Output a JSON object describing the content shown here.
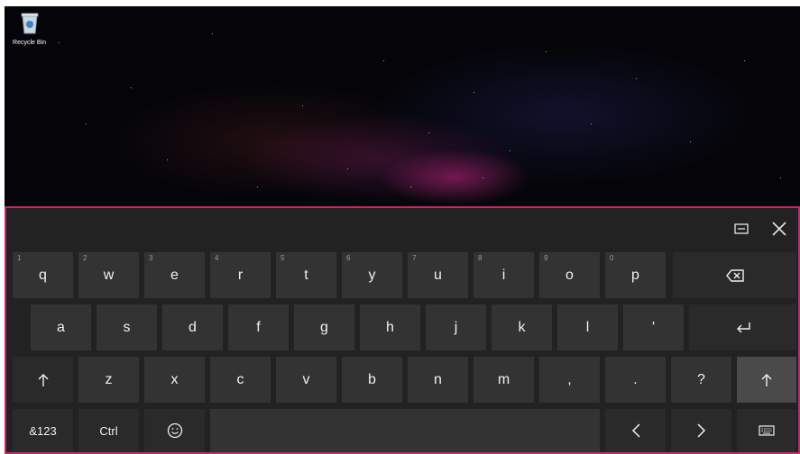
{
  "desktop": {
    "recycle_bin_label": "Recycle Bin"
  },
  "keyboard": {
    "row1": [
      {
        "hint": "1",
        "label": "q"
      },
      {
        "hint": "2",
        "label": "w"
      },
      {
        "hint": "3",
        "label": "e"
      },
      {
        "hint": "4",
        "label": "r"
      },
      {
        "hint": "5",
        "label": "t"
      },
      {
        "hint": "6",
        "label": "y"
      },
      {
        "hint": "7",
        "label": "u"
      },
      {
        "hint": "8",
        "label": "i"
      },
      {
        "hint": "9",
        "label": "o"
      },
      {
        "hint": "0",
        "label": "p"
      }
    ],
    "row2": [
      {
        "label": "a"
      },
      {
        "label": "s"
      },
      {
        "label": "d"
      },
      {
        "label": "f"
      },
      {
        "label": "g"
      },
      {
        "label": "h"
      },
      {
        "label": "j"
      },
      {
        "label": "k"
      },
      {
        "label": "l"
      },
      {
        "label": "'"
      }
    ],
    "row3": [
      {
        "label": "z"
      },
      {
        "label": "x"
      },
      {
        "label": "c"
      },
      {
        "label": "v"
      },
      {
        "label": "b"
      },
      {
        "label": "n"
      },
      {
        "label": "m"
      },
      {
        "label": ","
      },
      {
        "label": "."
      },
      {
        "label": "?"
      }
    ],
    "symbols_label": "&123",
    "ctrl_label": "Ctrl"
  },
  "colors": {
    "accent_border": "#c2296a",
    "keyboard_bg": "#222223",
    "key_bg": "#333334"
  }
}
